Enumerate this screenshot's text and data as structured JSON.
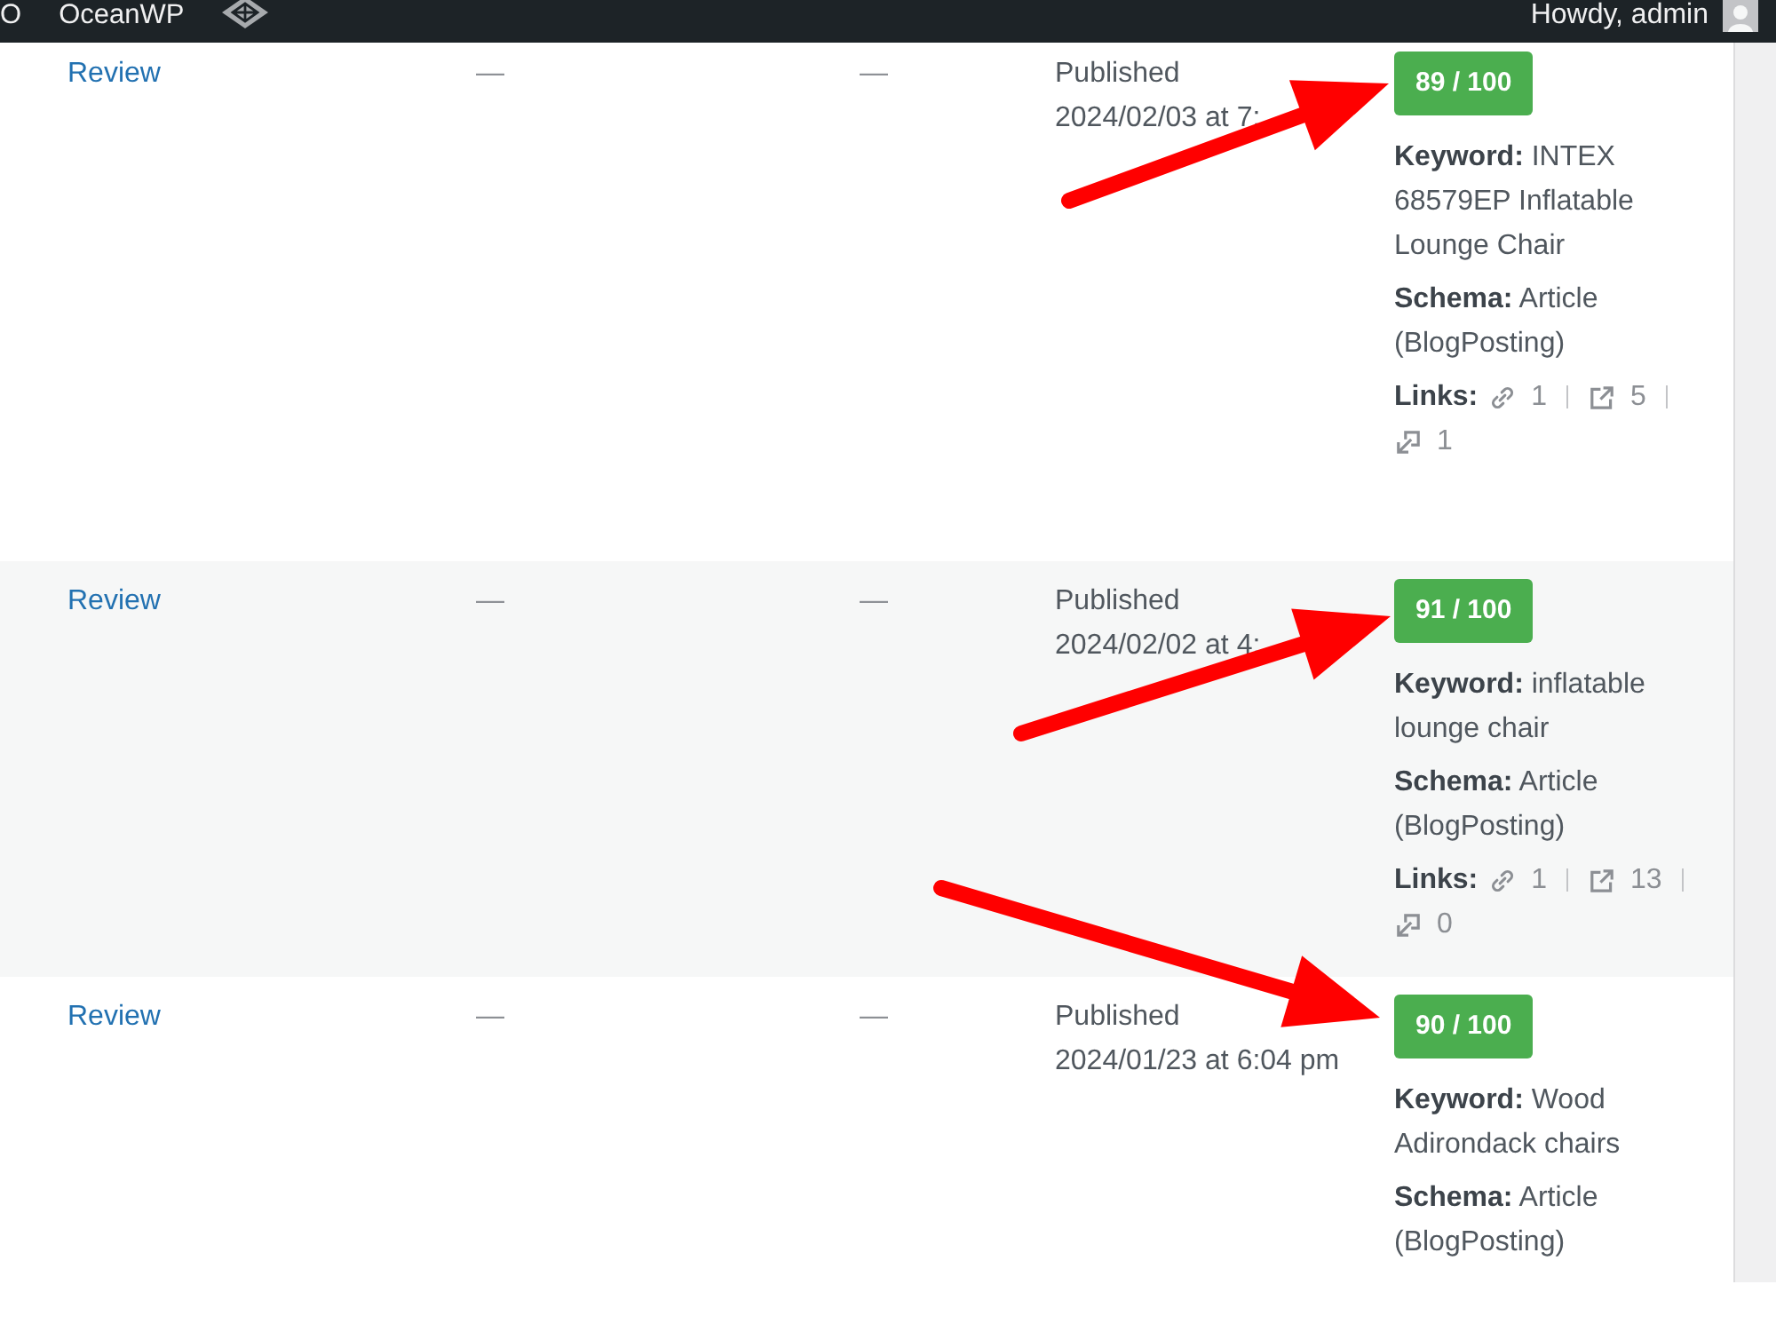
{
  "admin_bar": {
    "items": [
      "O",
      "OceanWP"
    ],
    "greeting": "Howdy, admin"
  },
  "rows": [
    {
      "column_1": "Review",
      "column_2": "—",
      "column_3": "—",
      "status": "Published",
      "date": "2024/02/03 at 7:",
      "score": "89 / 100",
      "keyword": "**Keyword:** INTEX 68579EP Inflatable Lounge Chair",
      "schema": "**Schema:** Article (BlogPosting)",
      "links_label": "Links:",
      "links": [
        {
          "kind": "internal",
          "count": "1"
        },
        {
          "kind": "external",
          "count": "5"
        },
        {
          "kind": "incoming",
          "count": "1"
        }
      ],
      "arrow": true
    },
    {
      "column_1": "Review",
      "column_2": "—",
      "column_3": "—",
      "status": "Published",
      "date": "2024/02/02 at 4:",
      "score": "91 / 100",
      "keyword": "**Keyword:** inflatable lounge chair",
      "schema": "**Schema:** Article (BlogPosting)",
      "links_label": "Links:",
      "links": [
        {
          "kind": "internal",
          "count": "1"
        },
        {
          "kind": "external",
          "count": "13"
        },
        {
          "kind": "incoming",
          "count": "0"
        }
      ],
      "arrow": true
    },
    {
      "column_1": "Review",
      "column_2": "—",
      "column_3": "—",
      "status": "Published",
      "date": "2024/01/23 at 6:04 pm",
      "score": "90 / 100",
      "keyword": "**Keyword:** Wood Adirondack chairs",
      "schema": "**Schema:** Article (BlogPosting)",
      "arrow": true
    }
  ]
}
